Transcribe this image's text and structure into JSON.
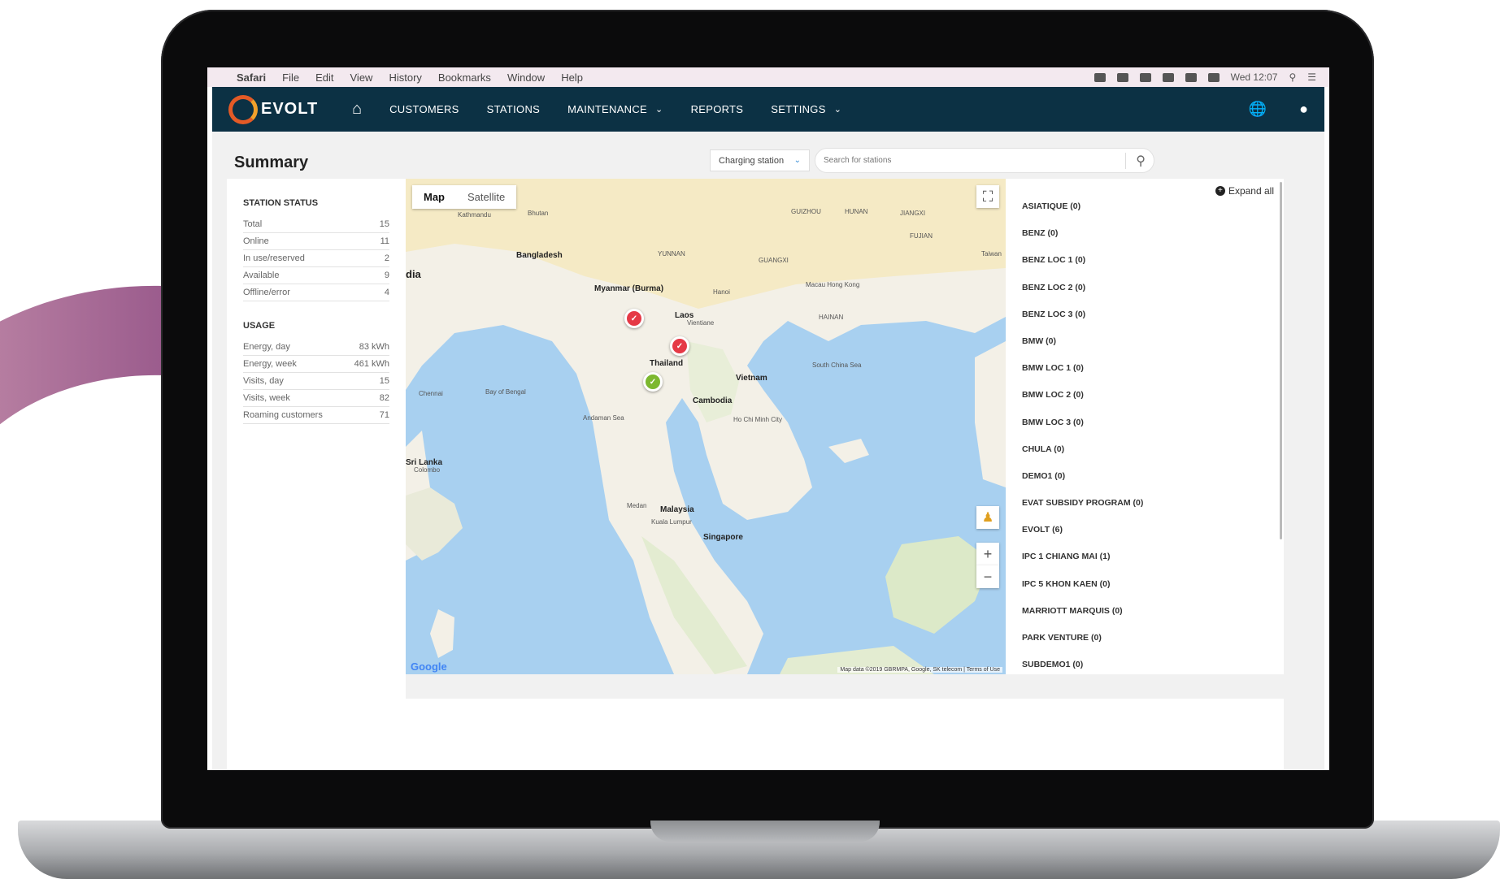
{
  "menubar": {
    "items": [
      "Safari",
      "File",
      "Edit",
      "View",
      "History",
      "Bookmarks",
      "Window",
      "Help"
    ],
    "clock": "Wed 12:07"
  },
  "nav": {
    "brand": "EVOLT",
    "items": {
      "customers": "CUSTOMERS",
      "stations": "STATIONS",
      "maintenance": "MAINTENANCE",
      "reports": "REPORTS",
      "settings": "SETTINGS"
    }
  },
  "page": {
    "title": "Summary",
    "filter_value": "Charging station",
    "search_placeholder": "Search for stations"
  },
  "station_status": {
    "heading": "STATION STATUS",
    "rows": [
      {
        "label": "Total",
        "value": "15"
      },
      {
        "label": "Online",
        "value": "11"
      },
      {
        "label": "In use/reserved",
        "value": "2"
      },
      {
        "label": "Available",
        "value": "9"
      },
      {
        "label": "Offline/error",
        "value": "4"
      }
    ]
  },
  "usage": {
    "heading": "USAGE",
    "rows": [
      {
        "label": "Energy, day",
        "value": "83 kWh"
      },
      {
        "label": "Energy, week",
        "value": "461 kWh"
      },
      {
        "label": "Visits, day",
        "value": "15"
      },
      {
        "label": "Visits, week",
        "value": "82"
      },
      {
        "label": "Roaming customers",
        "value": "71"
      }
    ]
  },
  "map": {
    "tabs": {
      "map": "Map",
      "satellite": "Satellite"
    },
    "labels": {
      "myanmar": "Myanmar (Burma)",
      "laos": "Laos",
      "thailand": "Thailand",
      "cambodia": "Cambodia",
      "vietnam": "Vietnam",
      "malaysia": "Malaysia",
      "singapore": "Singapore",
      "bangladesh": "Bangladesh",
      "srilanka": "Sri Lanka",
      "hanoi": "Hanoi",
      "hochiminh": "Ho Chi Minh City",
      "kualalumpur": "Kuala Lumpur",
      "medan": "Medan",
      "taiwan": "Taiwan",
      "hongkong": "Macau Hong Kong",
      "bay": "Bay of Bengal",
      "andaman": "Andaman Sea",
      "scs": "South China Sea",
      "india": "dia",
      "bhutan": "Bhutan",
      "kathmandu": "Kathmandu",
      "chennai": "Chennai",
      "colombo": "Colombo",
      "vientiane": "Vientiane",
      "yunnan": "YUNNAN",
      "guangxi": "GUANGXI",
      "fujian": "FUJIAN",
      "hunan": "HUNAN",
      "jiangxi": "JIANGXI",
      "guizhou": "GUIZHOU",
      "hainan": "HAINAN"
    },
    "google": "Google",
    "attribution": "Map data ©2019 GBRMPA, Google, SK telecom | Terms of Use"
  },
  "locations": {
    "expand_label": "Expand all",
    "items": [
      "ASIATIQUE (0)",
      "BENZ (0)",
      "BENZ LOC 1 (0)",
      "BENZ LOC 2 (0)",
      "BENZ LOC 3 (0)",
      "BMW (0)",
      "BMW LOC 1 (0)",
      "BMW LOC 2 (0)",
      "BMW LOC 3 (0)",
      "CHULA (0)",
      "DEMO1 (0)",
      "EVAT SUBSIDY PROGRAM (0)",
      "EVOLT (6)",
      "IPC 1 CHIANG MAI (1)",
      "IPC 5 KHON KAEN (0)",
      "MARRIOTT MARQUIS (0)",
      "PARK VENTURE (0)",
      "SUBDEMO1 (0)"
    ]
  },
  "colors": {
    "nav_bg": "#0c3144",
    "accent_orange": "#e35a26",
    "marker_red": "#e53946",
    "marker_green": "#7cb82f"
  }
}
